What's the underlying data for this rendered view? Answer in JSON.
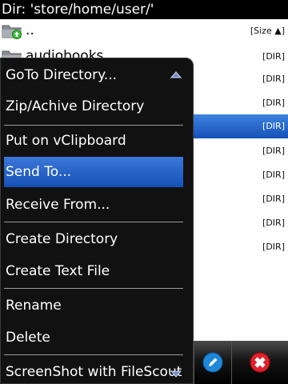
{
  "title_bar": {
    "text": "Dir: 'store/home/user/'"
  },
  "file_list": {
    "rows": [
      {
        "name": "..",
        "meta": "[Size ▲]"
      },
      {
        "name": "audiobooks",
        "meta": "[DIR]"
      },
      {
        "name": "",
        "meta": "[DIR]"
      },
      {
        "name": "",
        "meta": "[DIR]"
      },
      {
        "name": "",
        "meta": "[DIR]"
      },
      {
        "name": "",
        "meta": "[DIR]"
      },
      {
        "name": "",
        "meta": "[DIR]"
      },
      {
        "name": "",
        "meta": "[DIR]"
      },
      {
        "name": "",
        "meta": "[DIR]"
      },
      {
        "name": "",
        "meta": "[DIR]"
      }
    ],
    "selected_index": 4
  },
  "context_menu": {
    "items": [
      {
        "label": "GoTo Directory..."
      },
      {
        "label": "Zip/Achive Directory"
      },
      {
        "label": "Put on vClipboard"
      },
      {
        "label": "Send To..."
      },
      {
        "label": "Receive From..."
      },
      {
        "label": "Create Directory"
      },
      {
        "label": "Create Text File"
      },
      {
        "label": "Rename"
      },
      {
        "label": "Delete"
      },
      {
        "label": "ScreenShot with FileScout"
      }
    ],
    "selected_index": 3,
    "scroll_up_icon": "triangle-up-icon",
    "scroll_down_icon": "triangle-down-icon"
  },
  "toolbar": {
    "buttons": [
      {
        "icon": "edit-pencil-icon"
      },
      {
        "icon": "delete-cross-icon"
      }
    ]
  },
  "colors": {
    "selection_blue": "#1f5fc5",
    "menu_background": "#111111",
    "delete_red": "#e0202a"
  }
}
